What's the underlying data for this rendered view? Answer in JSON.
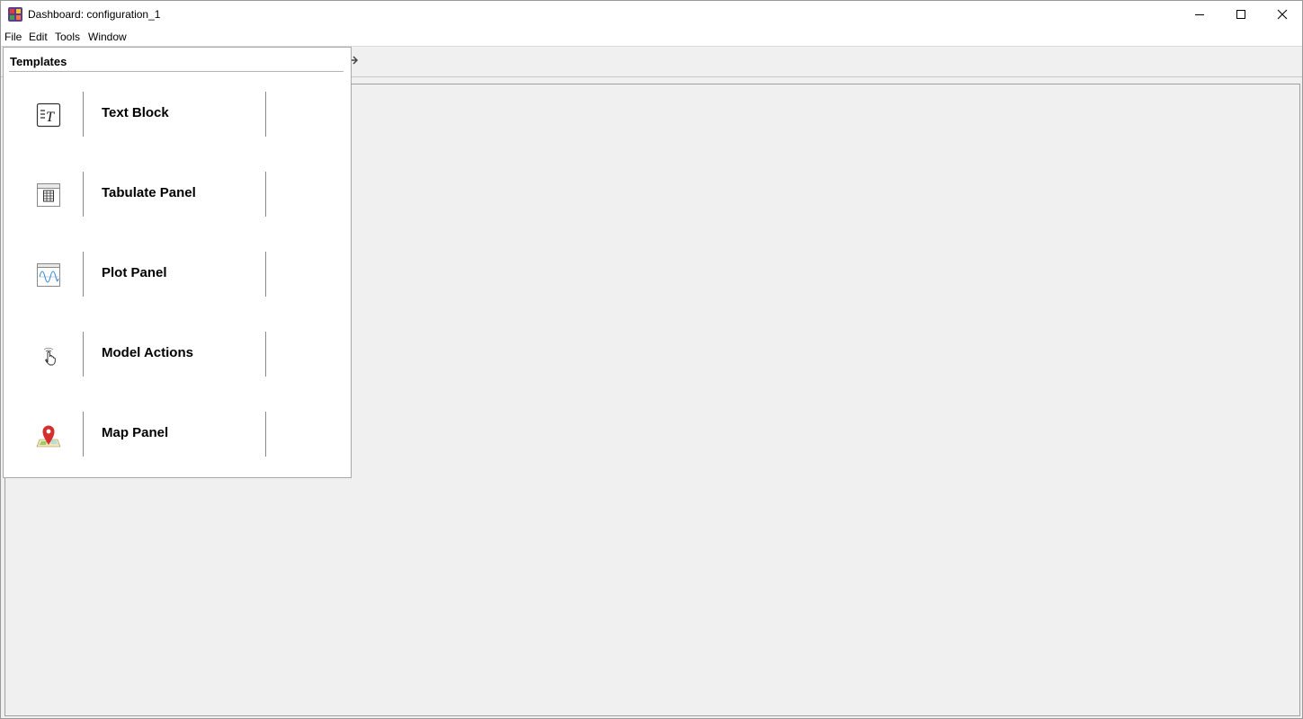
{
  "window": {
    "title": "Dashboard: configuration_1",
    "controls": [
      "minimize-icon",
      "maximize-icon",
      "close-icon"
    ]
  },
  "menubar": {
    "items": [
      "File",
      "Edit",
      "Tools",
      "Window"
    ]
  },
  "templates": {
    "header": "Templates",
    "items": [
      {
        "label": "Text Block",
        "icon": "text-block-icon"
      },
      {
        "label": "Tabulate Panel",
        "icon": "table-icon"
      },
      {
        "label": "Plot Panel",
        "icon": "plot-icon"
      },
      {
        "label": "Model Actions",
        "icon": "hand-pointer-icon"
      },
      {
        "label": "Map Panel",
        "icon": "map-pin-icon"
      }
    ]
  },
  "colors": {
    "background": "#f0f0f0",
    "map_pin": "#d32f2f",
    "plot_line": "#3a8fd6"
  }
}
